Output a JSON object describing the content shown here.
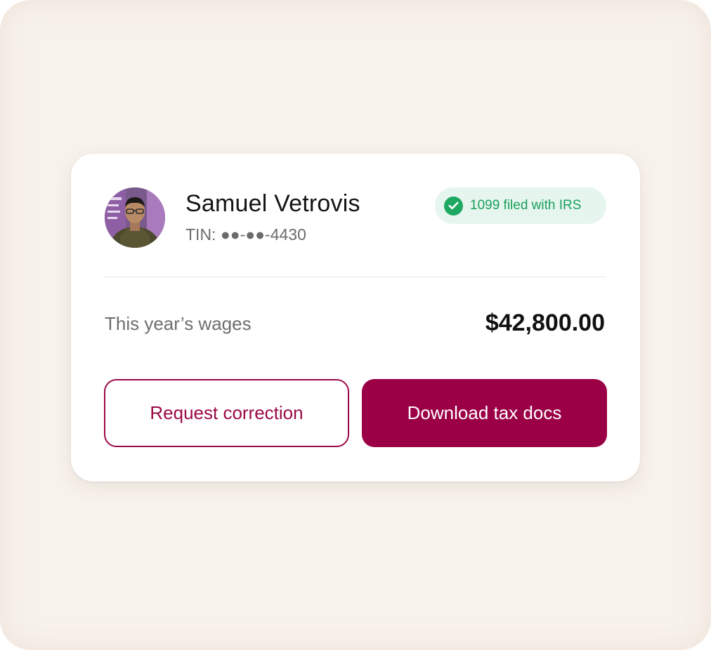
{
  "employee": {
    "name": "Samuel Vetrovis",
    "tin": "TIN: ●●-●●-4430"
  },
  "status_badge": {
    "label": "1099 filed with IRS",
    "icon": "check-circle-icon",
    "color": "#1fa862"
  },
  "wages": {
    "label": "This year’s wages",
    "value": "$42,800.00"
  },
  "actions": {
    "request_correction": "Request correction",
    "download_tax_docs": "Download tax docs"
  },
  "colors": {
    "brand": "#9b0046",
    "success": "#1fa862",
    "background": "#f8f2ec"
  }
}
